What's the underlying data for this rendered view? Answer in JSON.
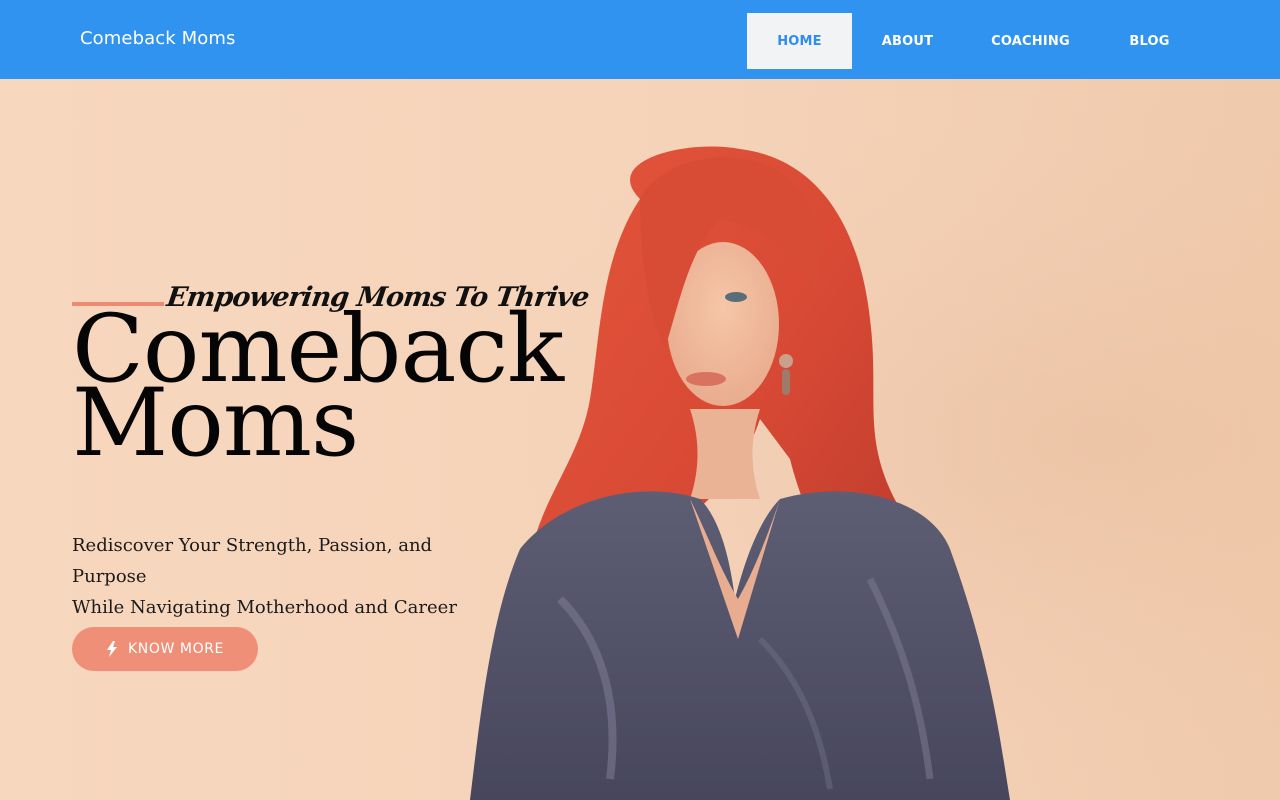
{
  "header": {
    "brand": "Comeback Moms",
    "nav": [
      {
        "label": "HOME",
        "active": true
      },
      {
        "label": "ABOUT",
        "active": false
      },
      {
        "label": "COACHING",
        "active": false
      },
      {
        "label": "BLOG",
        "active": false
      }
    ]
  },
  "hero": {
    "tagline": "Empowering Moms To Thrive",
    "title_line1": "Comeback",
    "title_line2": "Moms",
    "subtitle_line1": "Rediscover Your Strength, Passion, and Purpose",
    "subtitle_line2": "While Navigating Motherhood and Career",
    "cta_label": "KNOW MORE",
    "cta_icon": "bolt-icon",
    "image": "woman-red-hair-portrait"
  },
  "colors": {
    "navbar": "#3093f0",
    "accent": "#ef8f78",
    "background": "#f6d6bd"
  }
}
